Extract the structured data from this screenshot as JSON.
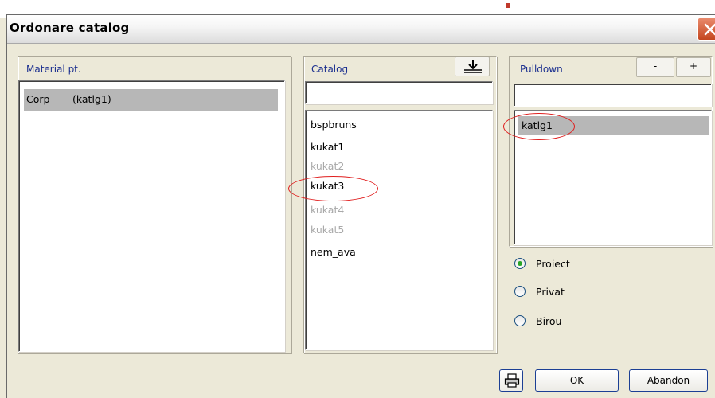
{
  "dialog": {
    "title": "Ordonare catalog"
  },
  "material_panel": {
    "label": "Material pt.",
    "items": [
      {
        "name": "Corp",
        "catalog": "(katlg1)",
        "selected": true
      }
    ]
  },
  "catalog_panel": {
    "label": "Catalog",
    "filter_value": "",
    "items": [
      {
        "label": "bspbruns",
        "enabled": true
      },
      {
        "label": "kukat1",
        "enabled": true
      },
      {
        "label": "kukat2",
        "enabled": false
      },
      {
        "label": "kukat3",
        "enabled": true
      },
      {
        "label": "kukat4",
        "enabled": false
      },
      {
        "label": "kukat5",
        "enabled": false
      },
      {
        "label": "nem_ava",
        "enabled": true
      }
    ],
    "download_icon": "download-icon"
  },
  "pulldown_panel": {
    "label": "Pulldown",
    "minus_label": "-",
    "plus_label": "+",
    "filter_value": "",
    "items": [
      {
        "label": "katlg1",
        "selected": true
      }
    ]
  },
  "scope": {
    "options": [
      "Proiect",
      "Privat",
      "Birou"
    ],
    "selected": "Proiect",
    "accent_color": "#28a428"
  },
  "footer": {
    "print_icon": "printer-icon",
    "ok_label": "OK",
    "cancel_label": "Abandon"
  },
  "annotations": {
    "highlight_color": "#e01e1e"
  }
}
